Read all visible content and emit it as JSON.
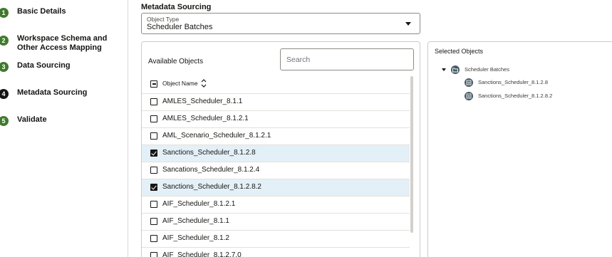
{
  "steps": [
    {
      "number": "1",
      "label": "Basic Details"
    },
    {
      "number": "2",
      "label": "Workspace Schema and Other Access Mapping"
    },
    {
      "number": "3",
      "label": "Data Sourcing"
    },
    {
      "number": "4",
      "label": "Metadata Sourcing"
    },
    {
      "number": "5",
      "label": "Validate"
    }
  ],
  "main": {
    "title": "Metadata Sourcing",
    "object_type": {
      "label": "Object Type",
      "value": "Scheduler Batches"
    }
  },
  "available": {
    "title": "Available Objects",
    "search_placeholder": "Search",
    "column_header": "Object Name",
    "rows": [
      {
        "label": "AMLES_Scheduler_8.1.1",
        "checked": false
      },
      {
        "label": "AMLES_Scheduler_8.1.2.1",
        "checked": false
      },
      {
        "label": "AML_Scenario_Scheduler_8.1.2.1",
        "checked": false
      },
      {
        "label": "Sanctions_Scheduler_8.1.2.8",
        "checked": true
      },
      {
        "label": "Sancations_Scheduler_8.1.2.4",
        "checked": false
      },
      {
        "label": "Sanctions_Scheduler_8.1.2.8.2",
        "checked": true
      },
      {
        "label": "AIF_Scheduler_8.1.2.1",
        "checked": false
      },
      {
        "label": "AIF_Scheduler_8.1.1",
        "checked": false
      },
      {
        "label": "AIF_Scheduler_8.1.2",
        "checked": false
      },
      {
        "label": "AIF_Scheduler_8.1.2.7.0",
        "checked": false
      }
    ]
  },
  "selected": {
    "title": "Selected Objects",
    "root": "Scheduler Batches",
    "children": [
      "Sanctions_Scheduler_8.1.2.8",
      "Sanctions_Scheduler_8.1.2.8.2"
    ]
  },
  "colors": {
    "step_done": "#3f7a2c",
    "step_current": "#161513",
    "row_selected_bg": "#e4f0f7",
    "tree_icon": "#455a64"
  }
}
